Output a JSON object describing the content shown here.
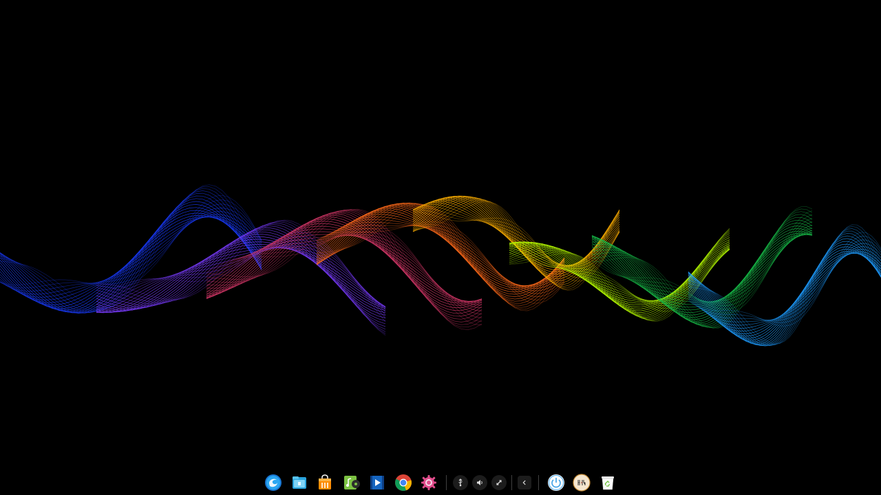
{
  "wallpaper": {
    "name": "rainbow-wave-lines",
    "colors": [
      "#1a3cff",
      "#7a3cff",
      "#d8386a",
      "#ff6a1a",
      "#ffb000",
      "#b8ff00",
      "#18c04a",
      "#1e9cff"
    ]
  },
  "dock": {
    "apps": [
      {
        "name": "deepin-launcher-icon",
        "icon": "swirl-logo",
        "color": "#1e88e5"
      },
      {
        "name": "file-manager-icon",
        "icon": "folder",
        "color": "#36b3e6"
      },
      {
        "name": "app-store-icon",
        "icon": "shopping-bag",
        "color": "#ff8a00"
      },
      {
        "name": "music-player-icon",
        "icon": "music-note",
        "color": "#7bc143"
      },
      {
        "name": "video-player-icon",
        "icon": "film",
        "color": "#1e63d6"
      },
      {
        "name": "chrome-browser-icon",
        "icon": "chrome",
        "color": "#db4437"
      },
      {
        "name": "settings-icon",
        "icon": "gear",
        "color": "#e24c8c"
      }
    ],
    "tray": [
      {
        "name": "usb-tray-icon",
        "icon": "usb"
      },
      {
        "name": "volume-tray-icon",
        "icon": "speaker"
      },
      {
        "name": "network-tray-icon",
        "icon": "arrows"
      },
      {
        "name": "collapse-tray-icon",
        "icon": "chevron-left"
      }
    ],
    "system": [
      {
        "name": "power-icon",
        "icon": "power"
      },
      {
        "name": "clock-icon",
        "icon": "clock"
      },
      {
        "name": "trash-icon",
        "icon": "trash"
      }
    ]
  }
}
